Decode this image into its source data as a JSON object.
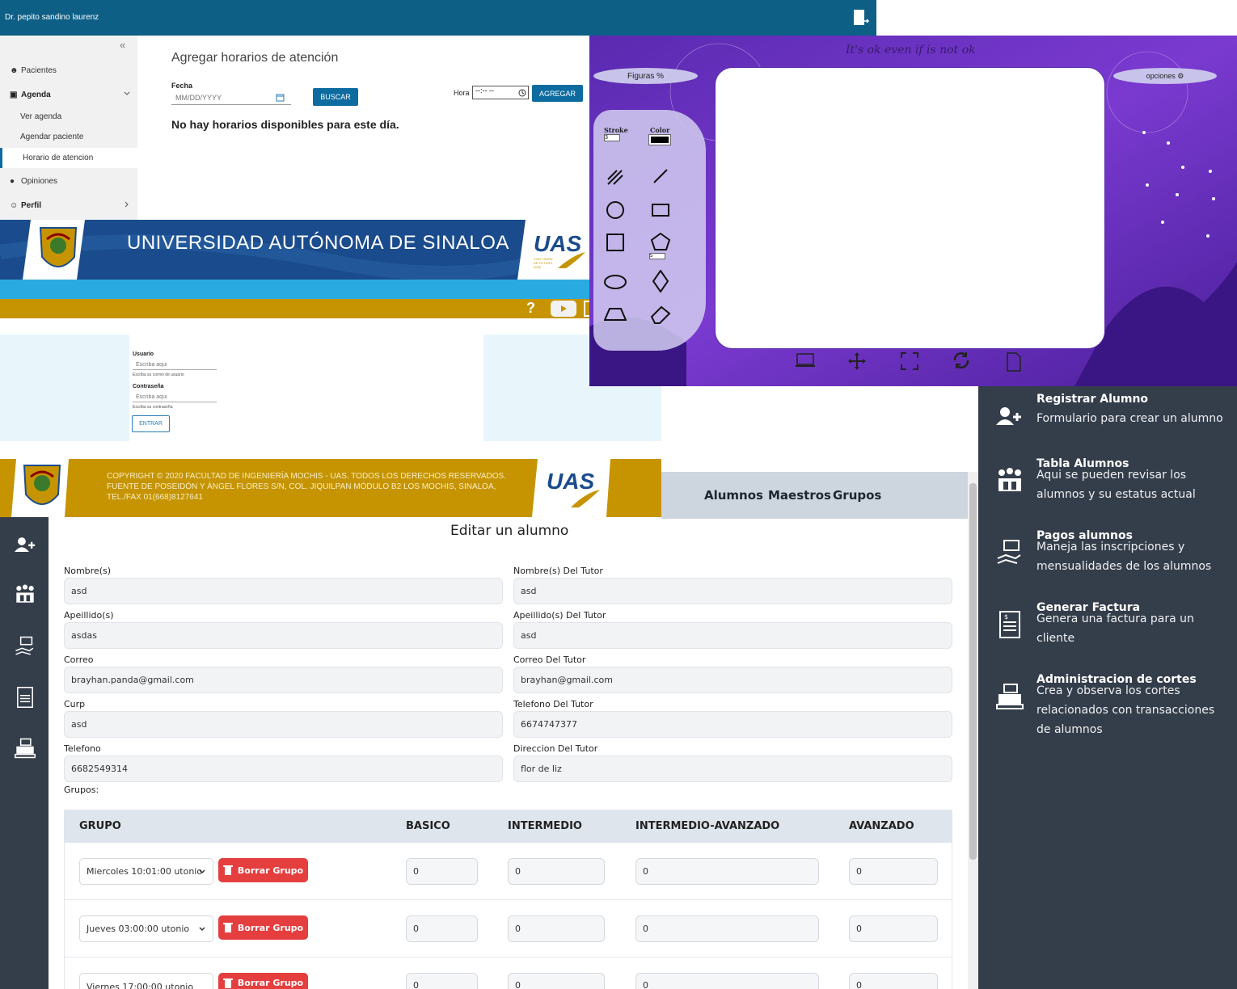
{
  "header": {
    "doctor_name": "Dr. pepito sandino laurenz"
  },
  "sidebar": {
    "collapse_glyph": "«",
    "items": [
      {
        "label": "Pacientes"
      },
      {
        "label": "Agenda"
      },
      {
        "label": "Ver agenda"
      },
      {
        "label": "Agendar paciente"
      },
      {
        "label": "Horario de atencion"
      },
      {
        "label": "Opiniones"
      },
      {
        "label": "Perfil"
      }
    ]
  },
  "schedule": {
    "title": "Agregar horarios de atención",
    "fecha_label": "Fecha",
    "fecha_placeholder": "MM/DD/YYYY",
    "buscar_label": "BUSCAR",
    "hora_label": "Hora",
    "hora_value": "--:-- --",
    "agregar_label": "AGREGAR",
    "empty_message": "No hay horarios disponibles para este día."
  },
  "uas": {
    "title": "UNIVERSIDAD AUTÓNOMA DE SINALOA",
    "logo_text": "UAS",
    "logo_sub": "CON VISIÓN DE FUTURO 2025",
    "help_glyph": "?"
  },
  "login": {
    "usuario_label": "Usuario",
    "usuario_placeholder": "Escriba aqui",
    "usuario_help": "Escriba su correo de usuario",
    "password_label": "Contraseña",
    "password_placeholder": "Escriba aqui",
    "password_help": "Escriba su contraseña",
    "entrar_label": "ENTRAR"
  },
  "footer": {
    "copyright": "COPYRIGHT © 2020 FACULTAD DE INGENIERÍA MOCHIS - UAS. TODOS LOS DERECHOS RESERVADOS. FUENTE DE POSEIDÓN Y ÁNGEL FLORES S/N, COL. JIQUILPAN MÓDULO B2 LOS MOCHIS, SINALOA, TEL./FAX 01(668)8127641",
    "logo_text": "UAS"
  },
  "drawing": {
    "quote": "It's ok even if is not ok",
    "figuras_label": "Figuras",
    "opciones_label": "opciones",
    "stroke_label": "Stroke",
    "stroke_value": "3",
    "color_label": "Color",
    "color_value": "#000000",
    "sides_value": "5"
  },
  "right_menu": {
    "items": [
      {
        "title": "Registrar Alumno",
        "desc": "Formulario para crear un alumno"
      },
      {
        "title": "Tabla Alumnos",
        "desc": "Aqui se pueden revisar los alumnos y su estatus actual"
      },
      {
        "title": "Pagos alumnos",
        "desc": "Maneja las inscripciones y mensualidades de los alumnos"
      },
      {
        "title": "Generar Factura",
        "desc": "Genera una factura para un cliente"
      },
      {
        "title": "Administracion de cortes",
        "desc": "Crea y observa los cortes relacionados con transacciones de alumnos"
      }
    ]
  },
  "topnav": {
    "links": [
      "Alumnos",
      "Maestros",
      "Grupos"
    ]
  },
  "form": {
    "title": "Editar un alumno",
    "fields": {
      "nombre": {
        "label": "Nombre(s)",
        "value": "asd"
      },
      "apellido": {
        "label": "Apeillido(s)",
        "value": "asdas"
      },
      "correo": {
        "label": "Correo",
        "value": "brayhan.panda@gmail.com"
      },
      "curp": {
        "label": "Curp",
        "value": "asd"
      },
      "telefono": {
        "label": "Telefono",
        "value": "6682549314"
      },
      "nombre_tutor": {
        "label": "Nombre(s) Del Tutor",
        "value": "asd"
      },
      "apellido_tutor": {
        "label": "Apeillido(s) Del Tutor",
        "value": "asd"
      },
      "correo_tutor": {
        "label": "Correo Del Tutor",
        "value": "brayhan@gmail.com"
      },
      "telefono_tutor": {
        "label": "Telefono Del Tutor",
        "value": "6674747377"
      },
      "direccion_tutor": {
        "label": "Direccion Del Tutor",
        "value": "flor de liz"
      }
    },
    "grupos_label": "Grupos:",
    "table": {
      "headers": [
        "GRUPO",
        "BASICO",
        "INTERMEDIO",
        "INTERMEDIO-AVANZADO",
        "AVANZADO"
      ],
      "delete_label": "Borrar Grupo",
      "rows": [
        {
          "grupo": "Miercoles 10:01:00 utonio",
          "basico": "0",
          "intermedio": "0",
          "int_avanzado": "0",
          "avanzado": "0"
        },
        {
          "grupo": "Jueves 03:00:00 utonio",
          "basico": "0",
          "intermedio": "0",
          "int_avanzado": "0",
          "avanzado": "0"
        },
        {
          "grupo": "Viernes 17:00:00 utonio",
          "basico": "0",
          "intermedio": "0",
          "int_avanzado": "0",
          "avanzado": "0"
        }
      ]
    }
  },
  "colors": {
    "topbar": "#0d5f86",
    "uas_blue": "#1a4b8c",
    "uas_gold": "#c69400",
    "dark_panel": "#343d4a",
    "delete_red": "#e53e3e",
    "purple": "#6b2fc2"
  }
}
